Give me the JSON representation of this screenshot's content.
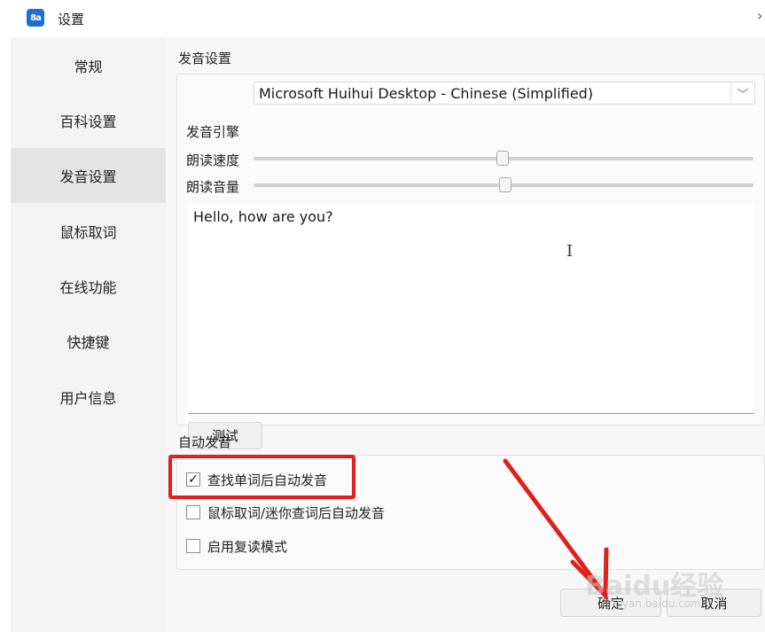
{
  "window": {
    "title": "设置",
    "app_icon_glyph": "8a",
    "close_glyph": "›"
  },
  "sidebar": {
    "items": [
      {
        "label": "常规"
      },
      {
        "label": "百科设置"
      },
      {
        "label": "发音设置",
        "active": true
      },
      {
        "label": "鼠标取词"
      },
      {
        "label": "在线功能"
      },
      {
        "label": "快捷键"
      },
      {
        "label": "用户信息"
      }
    ]
  },
  "pronunciation": {
    "section_title": "发音设置",
    "engine_label": "发音引擎",
    "engine_value": "Microsoft Huihui Desktop - Chinese (Simplified)",
    "speed_label": "朗读速度",
    "speed_value": 0.5,
    "volume_label": "朗读音量",
    "volume_value": 0.5,
    "test_text": "Hello, how are you?",
    "test_button": "测试"
  },
  "auto": {
    "section_title": "自动发音",
    "options": [
      {
        "label": "查找单词后自动发音",
        "checked": true
      },
      {
        "label": "鼠标取词/迷你查词后自动发音",
        "checked": false
      },
      {
        "label": "启用复读模式",
        "checked": false
      }
    ]
  },
  "footer": {
    "ok_button": "确定",
    "cancel_button": "取消"
  },
  "watermark": {
    "text": "Baidu经验",
    "sub": "jingyan.baidu.com"
  },
  "colors": {
    "accent": "#1d6fd6",
    "annotation_red": "#e0201c"
  }
}
